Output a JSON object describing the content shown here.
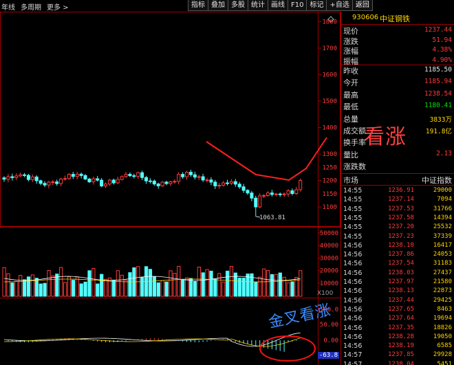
{
  "toolbar": {
    "left_tabs": [
      "年线",
      "多周期",
      "更多 >"
    ],
    "buttons": [
      "指标",
      "叠加",
      "多股",
      "统计",
      "画线",
      "F10",
      "标记",
      "+自选",
      "返回"
    ]
  },
  "panel": {
    "code": "930606",
    "name": "中证钢铁",
    "quote_rows_1": [
      {
        "label": "现价",
        "value": "1237.44",
        "color": "red"
      },
      {
        "label": "涨跌",
        "value": "51.94",
        "color": "red"
      },
      {
        "label": "涨幅",
        "value": "4.38%",
        "color": "red"
      },
      {
        "label": "振幅",
        "value": "4.90%",
        "color": "red"
      }
    ],
    "quote_rows_2": [
      {
        "label": "昨收",
        "value": "1185.50",
        "color": "white"
      },
      {
        "label": "今开",
        "value": "1185.94",
        "color": "red"
      },
      {
        "label": "最高",
        "value": "1238.54",
        "color": "red"
      },
      {
        "label": "最低",
        "value": "1180.41",
        "color": "green"
      },
      {
        "label": "总量",
        "value": "3833万",
        "color": "yellow"
      },
      {
        "label": "成交额",
        "value": "191.8亿",
        "color": "yellow"
      },
      {
        "label": "换手率",
        "value": "",
        "color": "white"
      },
      {
        "label": "量比",
        "value": "2.13",
        "color": "red"
      },
      {
        "label": "涨跌数",
        "value": "",
        "color": "white"
      }
    ],
    "tick_header": {
      "left": "市场",
      "right": "中证指数"
    },
    "ticks": [
      {
        "time": "14:55",
        "price": "1236.91",
        "vol": "29000"
      },
      {
        "time": "14:55",
        "price": "1237.14",
        "vol": "7094"
      },
      {
        "time": "14:55",
        "price": "1237.53",
        "vol": "31766"
      },
      {
        "time": "14:55",
        "price": "1237.58",
        "vol": "14394"
      },
      {
        "time": "14:55",
        "price": "1237.20",
        "vol": "25532"
      },
      {
        "time": "14:55",
        "price": "1237.23",
        "vol": "37339"
      },
      {
        "time": "14:56",
        "price": "1238.10",
        "vol": "16417"
      },
      {
        "time": "14:56",
        "price": "1237.86",
        "vol": "24053"
      },
      {
        "time": "14:56",
        "price": "1237.54",
        "vol": "31183"
      },
      {
        "time": "14:56",
        "price": "1238.03",
        "vol": "27437"
      },
      {
        "time": "14:56",
        "price": "1237.97",
        "vol": "21580"
      },
      {
        "time": "14:56",
        "price": "1238.13",
        "vol": "22873"
      },
      {
        "time": "14:56",
        "price": "1237.44",
        "vol": "29425"
      },
      {
        "time": "14:56",
        "price": "1237.65",
        "vol": "8463"
      },
      {
        "time": "14:56",
        "price": "1237.64",
        "vol": "19694"
      },
      {
        "time": "14:56",
        "price": "1237.35",
        "vol": "18826"
      },
      {
        "time": "14:56",
        "price": "1238.28",
        "vol": "19050"
      },
      {
        "time": "14:56",
        "price": "1238.19",
        "vol": "6585"
      },
      {
        "time": "14:57",
        "price": "1237.85",
        "vol": "29928"
      },
      {
        "time": "14:57",
        "price": "1238.04",
        "vol": "5451"
      }
    ]
  },
  "chart": {
    "price_axis": [
      "1800",
      "1700",
      "1600",
      "1500",
      "1400",
      "1300",
      "1200",
      "1100"
    ],
    "extra_price_ticks": [
      "1250",
      "1150"
    ],
    "volume_axis": [
      "50000",
      "40000",
      "30000",
      "20000",
      "10000"
    ],
    "volume_unit": "X100",
    "macd_axis": [
      "100.0",
      "50.00",
      "0.00"
    ],
    "low_label": "1063.81",
    "macd_value": "-63.8"
  },
  "annotations": {
    "bullish": "看涨",
    "golden_cross": "金叉看涨"
  },
  "colors": {
    "up": "#ff3c3c",
    "down": "#54ffff",
    "grid": "#a00000",
    "axis_text": "#ff3c3c",
    "panel_accent": "#ffd700"
  }
}
